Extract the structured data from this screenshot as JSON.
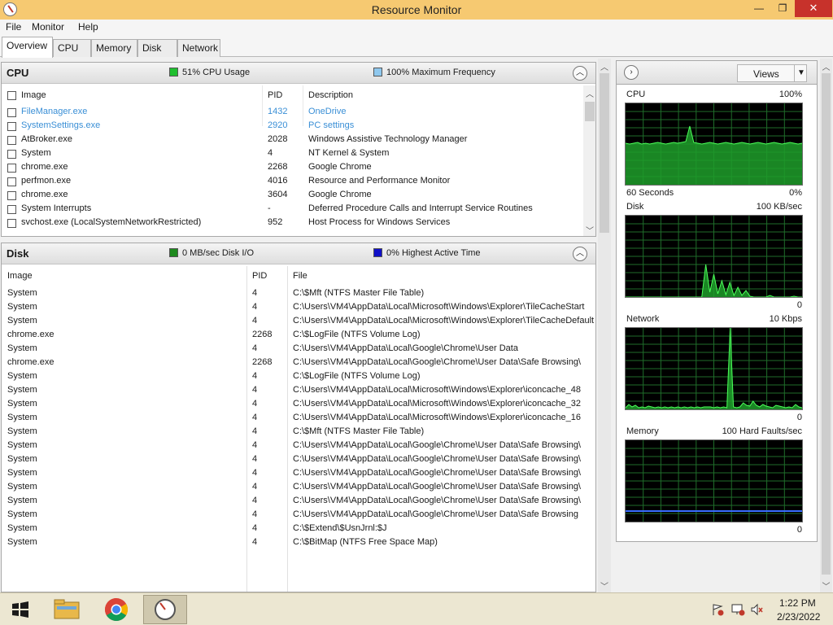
{
  "window": {
    "title": "Resource Monitor",
    "min_glyph": "—",
    "max_glyph": "❐",
    "close_glyph": "✕"
  },
  "menu": [
    "File",
    "Monitor",
    "Help"
  ],
  "tabs": [
    "Overview",
    "CPU",
    "Memory",
    "Disk",
    "Network"
  ],
  "active_tab": "Overview",
  "cpu": {
    "title": "CPU",
    "usage_label": "51% CPU Usage",
    "usage_color": "#1fbf2f",
    "freq_label": "100% Maximum Frequency",
    "freq_color": "#8fc8ee",
    "columns": [
      "Image",
      "PID",
      "Description"
    ],
    "rows": [
      {
        "image": "FileManager.exe",
        "pid": "1432",
        "description": "OneDrive",
        "link": true
      },
      {
        "image": "SystemSettings.exe",
        "pid": "2920",
        "description": "PC settings",
        "link": true
      },
      {
        "image": "AtBroker.exe",
        "pid": "2028",
        "description": "Windows Assistive Technology Manager"
      },
      {
        "image": "System",
        "pid": "4",
        "description": "NT Kernel & System"
      },
      {
        "image": "chrome.exe",
        "pid": "2268",
        "description": "Google Chrome"
      },
      {
        "image": "perfmon.exe",
        "pid": "4016",
        "description": "Resource and Performance Monitor"
      },
      {
        "image": "chrome.exe",
        "pid": "3604",
        "description": "Google Chrome"
      },
      {
        "image": "System Interrupts",
        "pid": "-",
        "description": "Deferred Procedure Calls and Interrupt Service Routines"
      },
      {
        "image": "svchost.exe (LocalSystemNetworkRestricted)",
        "pid": "952",
        "description": "Host Process for Windows Services"
      }
    ]
  },
  "disk": {
    "title": "Disk",
    "io_label": "0 MB/sec Disk I/O",
    "io_color": "#1e8a1e",
    "active_label": "0% Highest Active Time",
    "active_color": "#1010c8",
    "columns": [
      "Image",
      "PID",
      "File"
    ],
    "rows": [
      {
        "image": "System",
        "pid": "4",
        "file": "C:\\$Mft (NTFS Master File Table)"
      },
      {
        "image": "System",
        "pid": "4",
        "file": "C:\\Users\\VM4\\AppData\\Local\\Microsoft\\Windows\\Explorer\\TileCacheStart"
      },
      {
        "image": "System",
        "pid": "4",
        "file": "C:\\Users\\VM4\\AppData\\Local\\Microsoft\\Windows\\Explorer\\TileCacheDefault"
      },
      {
        "image": "chrome.exe",
        "pid": "2268",
        "file": "C:\\$LogFile (NTFS Volume Log)"
      },
      {
        "image": "System",
        "pid": "4",
        "file": "C:\\Users\\VM4\\AppData\\Local\\Google\\Chrome\\User Data"
      },
      {
        "image": "chrome.exe",
        "pid": "2268",
        "file": "C:\\Users\\VM4\\AppData\\Local\\Google\\Chrome\\User Data\\Safe Browsing\\"
      },
      {
        "image": "System",
        "pid": "4",
        "file": "C:\\$LogFile (NTFS Volume Log)"
      },
      {
        "image": "System",
        "pid": "4",
        "file": "C:\\Users\\VM4\\AppData\\Local\\Microsoft\\Windows\\Explorer\\iconcache_48"
      },
      {
        "image": "System",
        "pid": "4",
        "file": "C:\\Users\\VM4\\AppData\\Local\\Microsoft\\Windows\\Explorer\\iconcache_32"
      },
      {
        "image": "System",
        "pid": "4",
        "file": "C:\\Users\\VM4\\AppData\\Local\\Microsoft\\Windows\\Explorer\\iconcache_16"
      },
      {
        "image": "System",
        "pid": "4",
        "file": "C:\\$Mft (NTFS Master File Table)"
      },
      {
        "image": "System",
        "pid": "4",
        "file": "C:\\Users\\VM4\\AppData\\Local\\Google\\Chrome\\User Data\\Safe Browsing\\"
      },
      {
        "image": "System",
        "pid": "4",
        "file": "C:\\Users\\VM4\\AppData\\Local\\Google\\Chrome\\User Data\\Safe Browsing\\"
      },
      {
        "image": "System",
        "pid": "4",
        "file": "C:\\Users\\VM4\\AppData\\Local\\Google\\Chrome\\User Data\\Safe Browsing\\"
      },
      {
        "image": "System",
        "pid": "4",
        "file": "C:\\Users\\VM4\\AppData\\Local\\Google\\Chrome\\User Data\\Safe Browsing\\"
      },
      {
        "image": "System",
        "pid": "4",
        "file": "C:\\Users\\VM4\\AppData\\Local\\Google\\Chrome\\User Data\\Safe Browsing\\"
      },
      {
        "image": "System",
        "pid": "4",
        "file": "C:\\Users\\VM4\\AppData\\Local\\Google\\Chrome\\User Data\\Safe Browsing"
      },
      {
        "image": "System",
        "pid": "4",
        "file": "C:\\$Extend\\$UsnJrnl:$J"
      },
      {
        "image": "System",
        "pid": "4",
        "file": "C:\\$BitMap (NTFS Free Space Map)"
      }
    ]
  },
  "graphs_pane": {
    "views_label": "Views",
    "graphs": [
      {
        "name": "CPU",
        "top_right": "100%",
        "bottom_left": "60 Seconds",
        "bottom_right": "0%"
      },
      {
        "name": "Disk",
        "top_right": "100 KB/sec",
        "bottom_left": "",
        "bottom_right": "0"
      },
      {
        "name": "Network",
        "top_right": "10 Kbps",
        "bottom_left": "",
        "bottom_right": "0"
      },
      {
        "name": "Memory",
        "top_right": "100 Hard Faults/sec",
        "bottom_left": "",
        "bottom_right": "0"
      }
    ]
  },
  "chart_data": [
    {
      "type": "area",
      "title": "CPU",
      "ylim": [
        0,
        100
      ],
      "xlabel": "60 Seconds",
      "series": [
        {
          "values": [
            51,
            50,
            51,
            52,
            50,
            51,
            50,
            51,
            52,
            51,
            50,
            51,
            52,
            51,
            52,
            53,
            72,
            52,
            51,
            50,
            51,
            52,
            51,
            50,
            51,
            52,
            51,
            50,
            51,
            52,
            51,
            50,
            51,
            52,
            51,
            50,
            51,
            52,
            51,
            50,
            51,
            52,
            51,
            50,
            51
          ]
        }
      ]
    },
    {
      "type": "area",
      "title": "Disk",
      "ylim": [
        0,
        100
      ],
      "series": [
        {
          "values": [
            0,
            0,
            0,
            0,
            0,
            0,
            0,
            0,
            0,
            0,
            0,
            0,
            0,
            0,
            0,
            0,
            0,
            0,
            0,
            0,
            40,
            6,
            28,
            4,
            20,
            3,
            18,
            2,
            12,
            2,
            8,
            1,
            0,
            0,
            0,
            0,
            2,
            0,
            0,
            0,
            0,
            0,
            1,
            0,
            0
          ]
        }
      ]
    },
    {
      "type": "area",
      "title": "Network",
      "ylim": [
        0,
        10
      ],
      "series": [
        {
          "values": [
            0.2,
            0.6,
            0.3,
            0.5,
            0.2,
            0.3,
            0.2,
            0.4,
            0.3,
            0.2,
            0.3,
            0.2,
            0.3,
            0.2,
            0.3,
            0.2,
            0.3,
            0.2,
            0.3,
            0.2,
            0.3,
            0.2,
            0.3,
            0.2,
            0.3,
            0.3,
            0.3,
            0.2,
            0.3,
            0.2,
            0.3,
            0.2,
            10,
            0.3,
            0.2,
            0.3,
            0.8,
            0.5,
            0.4,
            1.0,
            0.5,
            0.3,
            0.6,
            0.4,
            0.3,
            0.2,
            0.5,
            0.4,
            0.3,
            0.2,
            0.3,
            0.2,
            0.6,
            0.3,
            0.2
          ]
        }
      ]
    },
    {
      "type": "line",
      "title": "Memory",
      "ylim": [
        0,
        100
      ],
      "series": [
        {
          "values": [
            13,
            13,
            13,
            13,
            13,
            13,
            13,
            13,
            13,
            13,
            13,
            13,
            13,
            13,
            13,
            13,
            13,
            13,
            13,
            13,
            13,
            13,
            13,
            13,
            13,
            13,
            13,
            13,
            13,
            13,
            13,
            13,
            13,
            13,
            13,
            13,
            13,
            13,
            13,
            13,
            13,
            13,
            13,
            13,
            13
          ]
        }
      ]
    }
  ],
  "taskbar": {
    "time": "1:22 PM",
    "date": "2/23/2022"
  }
}
